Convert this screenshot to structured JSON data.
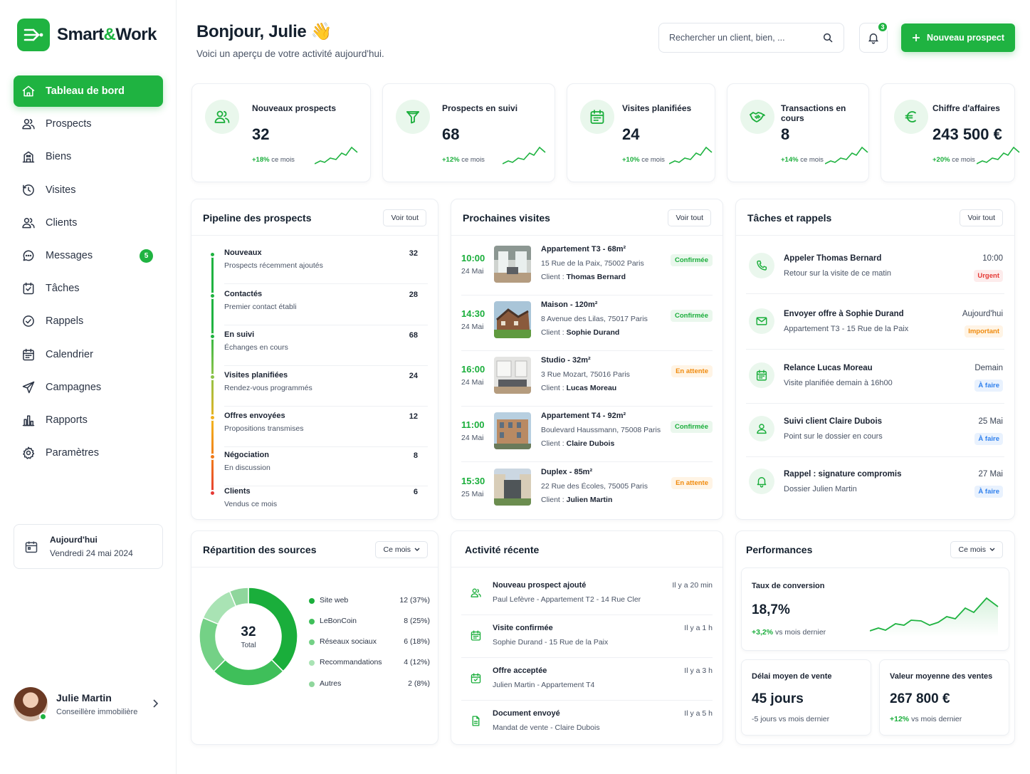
{
  "brand": {
    "name_part1": "Smart",
    "amp": "&",
    "name_part2": "Work",
    "color": "#1fb341"
  },
  "sidebar": {
    "items": [
      {
        "label": "Tableau de bord",
        "icon": "home-icon",
        "active": true
      },
      {
        "label": "Prospects",
        "icon": "users-icon"
      },
      {
        "label": "Biens",
        "icon": "building-icon"
      },
      {
        "label": "Visites",
        "icon": "clock-icon"
      },
      {
        "label": "Clients",
        "icon": "users-icon"
      },
      {
        "label": "Messages",
        "icon": "chat-icon",
        "badge": "5"
      },
      {
        "label": "Tâches",
        "icon": "checkbox-icon"
      },
      {
        "label": "Rappels",
        "icon": "check-circle-icon"
      },
      {
        "label": "Calendrier",
        "icon": "calendar-icon"
      },
      {
        "label": "Campagnes",
        "icon": "send-icon"
      },
      {
        "label": "Rapports",
        "icon": "bar-chart-icon"
      },
      {
        "label": "Paramètres",
        "icon": "gear-icon"
      }
    ],
    "today": {
      "title": "Aujourd'hui",
      "date": "Vendredi 24 mai 2024"
    },
    "user": {
      "name": "Julie Martin",
      "role": "Conseillère immobilière"
    }
  },
  "header": {
    "greeting": "Bonjour, Julie 👋",
    "subtitle": "Voici un aperçu de votre activité aujourd'hui.",
    "search_placeholder": "Rechercher un client, bien, ...",
    "notifications": "3",
    "new_button": "Nouveau prospect"
  },
  "kpis": [
    {
      "label": "Nouveaux prospects",
      "value": "32",
      "delta": "+18%",
      "delta_suffix": " ce mois",
      "icon": "users-icon"
    },
    {
      "label": "Prospects en suivi",
      "value": "68",
      "delta": "+12%",
      "delta_suffix": " ce mois",
      "icon": "funnel-icon"
    },
    {
      "label": "Visites planifiées",
      "value": "24",
      "delta": "+10%",
      "delta_suffix": " ce mois",
      "icon": "calendar-icon"
    },
    {
      "label": "Transactions en cours",
      "value": "8",
      "delta": "+14%",
      "delta_suffix": " ce mois",
      "icon": "handshake-icon"
    },
    {
      "label": "Chiffre d'affaires",
      "value": "243 500 €",
      "delta": "+20%",
      "delta_suffix": " ce mois",
      "icon": "euro-icon"
    }
  ],
  "pipeline": {
    "title": "Pipeline des prospects",
    "action": "Voir tout",
    "stages": [
      {
        "name": "Nouveaux",
        "desc": "Prospects récemment ajoutés",
        "count": "32",
        "color": "#1fb341"
      },
      {
        "name": "Contactés",
        "desc": "Premier contact établi",
        "count": "28",
        "color": "#1fb341"
      },
      {
        "name": "En suivi",
        "desc": "Échanges en cours",
        "count": "68",
        "color": "#1fb341"
      },
      {
        "name": "Visites planifiées",
        "desc": "Rendez-vous programmés",
        "count": "24",
        "color": "#8bc34a"
      },
      {
        "name": "Offres envoyées",
        "desc": "Propositions transmises",
        "count": "12",
        "color": "#f2b01e"
      },
      {
        "name": "Négociation",
        "desc": "En discussion",
        "count": "8",
        "color": "#f07a1a"
      },
      {
        "name": "Clients",
        "desc": "Vendus ce mois",
        "count": "6",
        "color": "#e53935"
      }
    ]
  },
  "visits": {
    "title": "Prochaines visites",
    "action": "Voir tout",
    "client_prefix": "Client : ",
    "items": [
      {
        "time": "10:00",
        "date": "24 Mai",
        "title": "Appartement T3 - 68m²",
        "address": "15 Rue de la Paix, 75002 Paris",
        "client": "Thomas Bernard",
        "status": "Confirmée",
        "kind": "ok"
      },
      {
        "time": "14:30",
        "date": "24 Mai",
        "title": "Maison - 120m²",
        "address": "8 Avenue des Lilas, 75017 Paris",
        "client": "Sophie Durand",
        "status": "Confirmée",
        "kind": "ok"
      },
      {
        "time": "16:00",
        "date": "24 Mai",
        "title": "Studio - 32m²",
        "address": "3 Rue Mozart, 75016 Paris",
        "client": "Lucas Moreau",
        "status": "En attente",
        "kind": "wait"
      },
      {
        "time": "11:00",
        "date": "24 Mai",
        "title": "Appartement T4 - 92m²",
        "address": "Boulevard Haussmann, 75008 Paris",
        "client": "Claire Dubois",
        "status": "Confirmée",
        "kind": "ok"
      },
      {
        "time": "15:30",
        "date": "25 Mai",
        "title": "Duplex - 85m²",
        "address": "22 Rue des Écoles, 75005 Paris",
        "client": "Julien Martin",
        "status": "En attente",
        "kind": "wait"
      }
    ]
  },
  "tasks": {
    "title": "Tâches et rappels",
    "action": "Voir tout",
    "items": [
      {
        "title": "Appeler Thomas Bernard",
        "desc": "Retour sur la visite de ce matin",
        "when": "10:00",
        "badge": "Urgent",
        "kind": "urg",
        "icon": "phone-icon"
      },
      {
        "title": "Envoyer offre à Sophie Durand",
        "desc": "Appartement T3 - 15 Rue de la Paix",
        "when": "Aujourd'hui",
        "badge": "Important",
        "kind": "imp",
        "icon": "mail-icon"
      },
      {
        "title": "Relance Lucas Moreau",
        "desc": "Visite planifiée demain à 16h00",
        "when": "Demain",
        "badge": "À faire",
        "kind": "todo",
        "icon": "calendar-icon"
      },
      {
        "title": "Suivi client Claire Dubois",
        "desc": "Point sur le dossier en cours",
        "when": "25 Mai",
        "badge": "À faire",
        "kind": "todo",
        "icon": "user-icon"
      },
      {
        "title": "Rappel : signature compromis",
        "desc": "Dossier Julien Martin",
        "when": "27 Mai",
        "badge": "À faire",
        "kind": "todo",
        "icon": "bell-icon"
      }
    ]
  },
  "sources": {
    "title": "Répartition des sources",
    "filter": "Ce mois",
    "total_value": "32",
    "total_label": "Total",
    "items": [
      {
        "name": "Site web",
        "label": "12 (37%)",
        "value": 12,
        "color": "#1aae3b"
      },
      {
        "name": "LeBonCoin",
        "label": "8 (25%)",
        "value": 8,
        "color": "#3fbf5a"
      },
      {
        "name": "Réseaux sociaux",
        "label": "6 (18%)",
        "value": 6,
        "color": "#74d186"
      },
      {
        "name": "Recommandations",
        "label": "4 (12%)",
        "value": 4,
        "color": "#a9e3b4"
      },
      {
        "name": "Autres",
        "label": "2 (8%)",
        "value": 2,
        "color": "#8fd69c"
      }
    ]
  },
  "activity": {
    "title": "Activité récente",
    "items": [
      {
        "title": "Nouveau prospect ajouté",
        "desc": "Paul Lefèvre - Appartement T2 - 14 Rue Cler",
        "when": "Il y a 20 min",
        "icon": "user-plus-icon"
      },
      {
        "title": "Visite confirmée",
        "desc": "Sophie Durand - 15 Rue de la Paix",
        "when": "Il y a 1 h",
        "icon": "calendar-icon"
      },
      {
        "title": "Offre acceptée",
        "desc": "Julien Martin - Appartement T4",
        "when": "Il y a 3 h",
        "icon": "calendar-check-icon"
      },
      {
        "title": "Document envoyé",
        "desc": "Mandat de vente - Claire Dubois",
        "when": "Il y a 5 h",
        "icon": "document-icon"
      }
    ]
  },
  "performance": {
    "title": "Performances",
    "filter": "Ce mois",
    "conversion": {
      "label": "Taux de conversion",
      "value": "18,7%",
      "delta": "+3,2%",
      "delta_suffix": " vs mois dernier"
    },
    "delay": {
      "label": "Délai moyen de vente",
      "value": "45 jours",
      "delta": "-5 jours vs mois dernier"
    },
    "average": {
      "label": "Valeur moyenne des ventes",
      "value": "267 800 €",
      "delta": "+12%",
      "delta_suffix": "  vs mois dernier"
    }
  }
}
